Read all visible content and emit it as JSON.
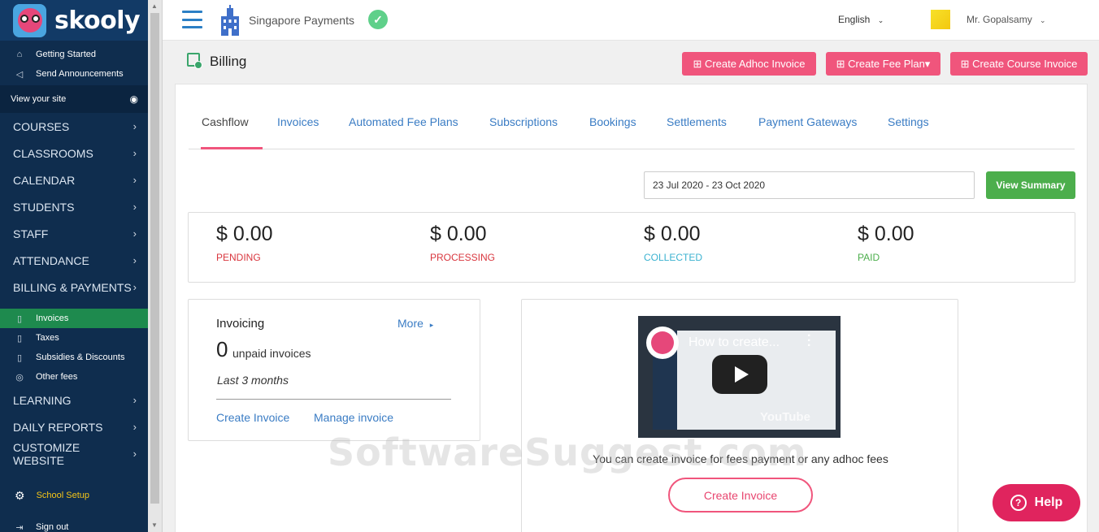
{
  "sidebar": {
    "logo_text": "skooly",
    "top_items": [
      {
        "label": "Getting Started",
        "icon": "home-icon"
      },
      {
        "label": "Send Announcements",
        "icon": "megaphone-icon"
      }
    ],
    "view_site": "View your site",
    "main_items": [
      {
        "label": "COURSES"
      },
      {
        "label": "CLASSROOMS"
      },
      {
        "label": "CALENDAR"
      },
      {
        "label": "STUDENTS"
      },
      {
        "label": "STAFF"
      },
      {
        "label": "ATTENDANCE"
      },
      {
        "label": "BILLING & PAYMENTS"
      }
    ],
    "billing_sub": [
      {
        "label": "Invoices",
        "active": true
      },
      {
        "label": "Taxes"
      },
      {
        "label": "Subsidies & Discounts"
      },
      {
        "label": "Other fees"
      }
    ],
    "lower_items": [
      {
        "label": "LEARNING"
      },
      {
        "label": "DAILY REPORTS"
      },
      {
        "label": "CUSTOMIZE WEBSITE"
      }
    ],
    "school_setup": "School Setup",
    "sign_out": "Sign out"
  },
  "topbar": {
    "school_name": "Singapore Payments",
    "language": "English",
    "user": "Mr. Gopalsamy"
  },
  "page": {
    "title": "Billing",
    "buttons": {
      "adhoc": "⊞ Create Adhoc Invoice",
      "fee_plan": "⊞  Create Fee Plan▾",
      "course": "⊞ Create Course Invoice"
    }
  },
  "tabs": [
    "Cashflow",
    "Invoices",
    "Automated Fee Plans",
    "Subscriptions",
    "Bookings",
    "Settlements",
    "Payment Gateways",
    "Settings"
  ],
  "date_range": "23 Jul 2020 - 23 Oct 2020",
  "view_summary": "View Summary",
  "stats": [
    {
      "amount": "$ 0.00",
      "label": "PENDING",
      "color": "#d9363e"
    },
    {
      "amount": "$ 0.00",
      "label": "PROCESSING",
      "color": "#d9363e"
    },
    {
      "amount": "$ 0.00",
      "label": "COLLECTED",
      "color": "#3bb2d0"
    },
    {
      "amount": "$ 0.00",
      "label": "PAID",
      "color": "#4cae4c"
    }
  ],
  "invoicing": {
    "title": "Invoicing",
    "more": "More",
    "count": "0",
    "unpaid_label": "unpaid invoices",
    "period": "Last 3 months",
    "create_link": "Create Invoice",
    "manage_link": "Manage invoice"
  },
  "video": {
    "title": "How to create...",
    "yt_logo": "YouTube",
    "caption": "You can create invoice for fees payment or any adhoc fees",
    "button": "Create Invoice"
  },
  "watermark": "SoftwareSuggest.com",
  "help": "Help",
  "colors": {
    "accent": "#f0557c",
    "sidebar": "#0f2d4e",
    "link": "#3a7cc4",
    "success": "#4cae4c"
  }
}
